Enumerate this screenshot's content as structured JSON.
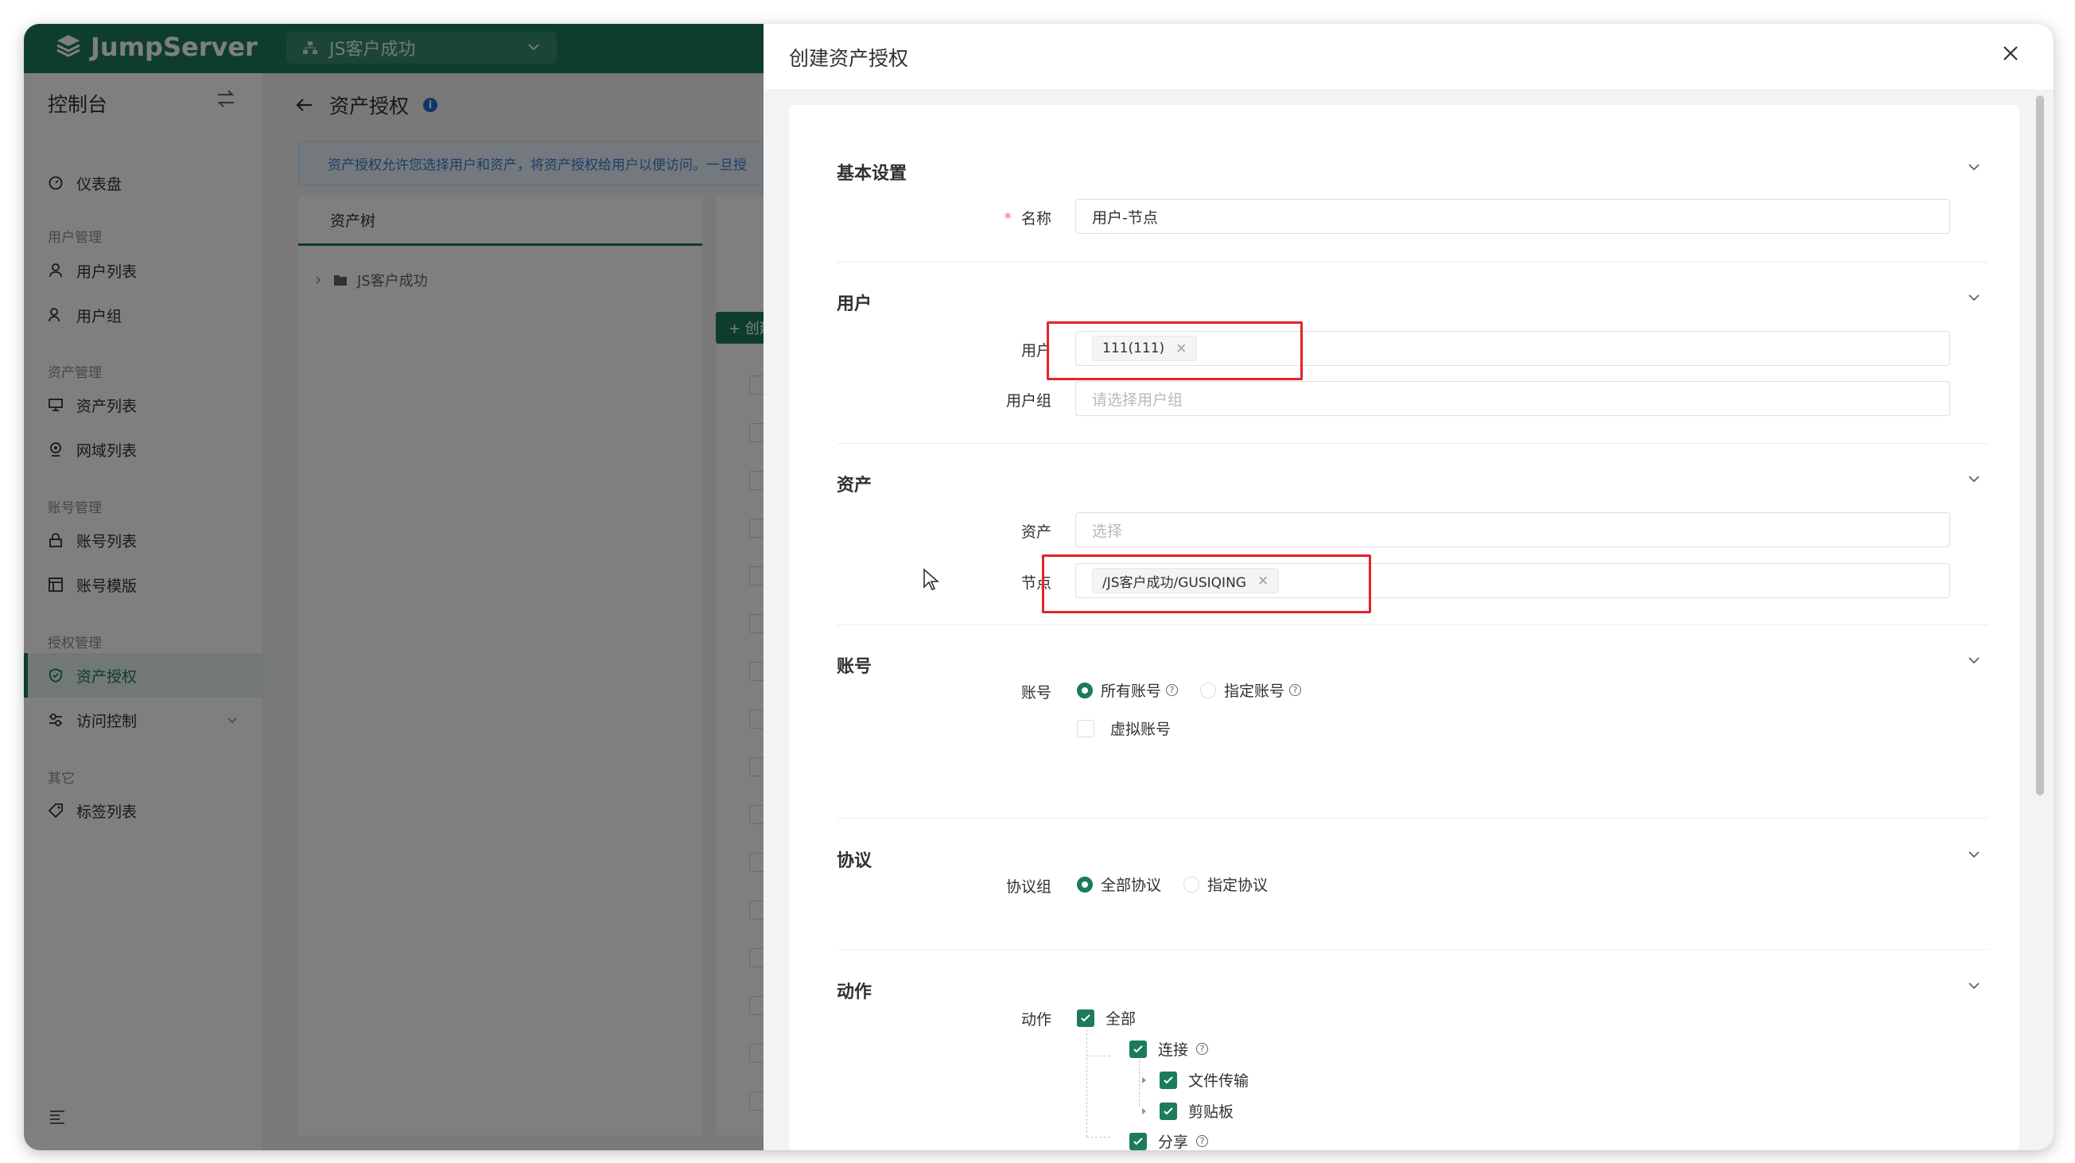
{
  "app": {
    "brand": "JumpServer",
    "org_selector": "JS客户成功"
  },
  "sidebar": {
    "title": "控制台",
    "groups": {
      "dashboard": "仪表盘",
      "user_mgmt": "用户管理",
      "user_list": "用户列表",
      "user_group": "用户组",
      "asset_mgmt": "资产管理",
      "asset_list": "资产列表",
      "domain_list": "网域列表",
      "account_mgmt": "账号管理",
      "account_list": "账号列表",
      "account_template": "账号模版",
      "perm_mgmt": "授权管理",
      "asset_perm": "资产授权",
      "access_control": "访问控制",
      "other": "其它",
      "label_list": "标签列表"
    }
  },
  "main": {
    "page_title": "资产授权",
    "alert": "资产授权允许您选择用户和资产，将资产授权给用户以便访问。一旦授",
    "tree_tab": "资产树",
    "tree_root": "JS客户成功",
    "create_btn": "+ 创建"
  },
  "drawer": {
    "title": "创建资产授权",
    "sections": {
      "basic": "基本设置",
      "users": "用户",
      "assets": "资产",
      "accounts": "账号",
      "protocols": "协议",
      "actions": "动作"
    },
    "fields": {
      "name_label": "名称",
      "name_value": "用户-节点",
      "users_label": "用户",
      "users_tag": "111(111)",
      "user_groups_label": "用户组",
      "user_groups_placeholder": "请选择用户组",
      "assets_label": "资产",
      "assets_placeholder": "选择",
      "nodes_label": "节点",
      "nodes_tag": "/JS客户成功/GUSIQING",
      "accounts_label": "账号",
      "all_accounts": "所有账号",
      "specified_accounts": "指定账号",
      "virtual_accounts": "虚拟账号",
      "protocol_group_label": "协议组",
      "all_protocols": "全部协议",
      "specified_protocols": "指定协议",
      "actions_label": "动作",
      "action_all": "全部",
      "action_connect": "连接",
      "action_transfer": "文件传输",
      "action_clipboard": "剪贴板",
      "action_share": "分享"
    }
  },
  "colors": {
    "brand": "#1c7a5e",
    "highlight": "#e3242b"
  }
}
